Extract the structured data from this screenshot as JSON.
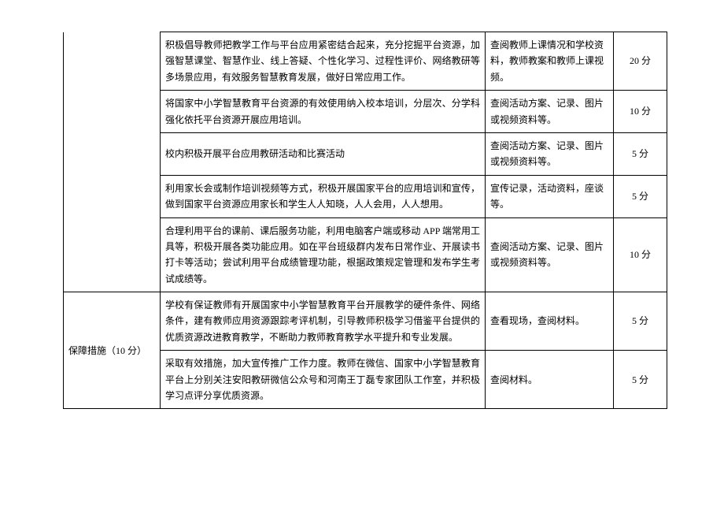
{
  "table": {
    "rows": [
      {
        "cat_rowspan": 5,
        "cat": "",
        "cat_class": "no-top",
        "desc": "积极倡导教师把教学工作与平台应用紧密结合起来，充分挖掘平台资源，加强智慧课堂、智慧作业、线上答疑、个性化学习、过程性评价、网络教研等多场景应用，有效服务智慧教育发展，做好日常应用工作。",
        "evid": "查阅教师上课情况和学校资料，教师教案和教师上课视频。",
        "score": "20 分"
      },
      {
        "desc": "将国家中小学智慧教育平台资源的有效使用纳入校本培训，分层次、分学科强化依托平台资源开展应用培训。",
        "evid": "查阅活动方案、记录、图片或视频资料等。",
        "score": "10 分"
      },
      {
        "desc": "校内积极开展平台应用教研活动和比赛活动",
        "evid": "查阅活动方案、记录、图片或视频资料等。",
        "score": "5 分"
      },
      {
        "desc": "利用家长会或制作培训视频等方式，积极开展国家平台的应用培训和宣传，做到国家平台资源应用家长和学生人人知晓，人人会用，人人想用。",
        "evid": "宣传记录，活动资料，座谈等。",
        "score": "5 分"
      },
      {
        "desc": "合理利用平台的课前、课后服务功能，利用电脑客户端或移动 APP 端常用工具等，积极开展各类功能应用。如在平台班级群内发布日常作业、开展读书打卡等活动；尝试利用平台成绩管理功能，根据政策规定管理和发布学生考试成绩等。",
        "evid": "查阅活动方案、记录、图片或视频资料等。",
        "score": "10 分"
      },
      {
        "cat_rowspan": 2,
        "cat": "保障措施（10 分）",
        "desc": "学校有保证教师有开展国家中小学智慧教育平台开展教学的硬件条件、网络条件，建有教师应用资源跟踪考评机制，引导教师积极学习借鉴平台提供的优质资源改进教育教学，不断助力教师教育教学水平提升和专业发展。",
        "evid": "查看现场，查阅材料。",
        "score": "5 分"
      },
      {
        "desc": "采取有效措施，加大宣传推广工作力度。教师在微信、国家中小学智慧教育平台上分别关注安阳教研微信公众号和河南王丁磊专家团队工作室，并积极学习点评分享优质资源。",
        "evid": "查阅材料。",
        "score": "5 分"
      }
    ]
  }
}
